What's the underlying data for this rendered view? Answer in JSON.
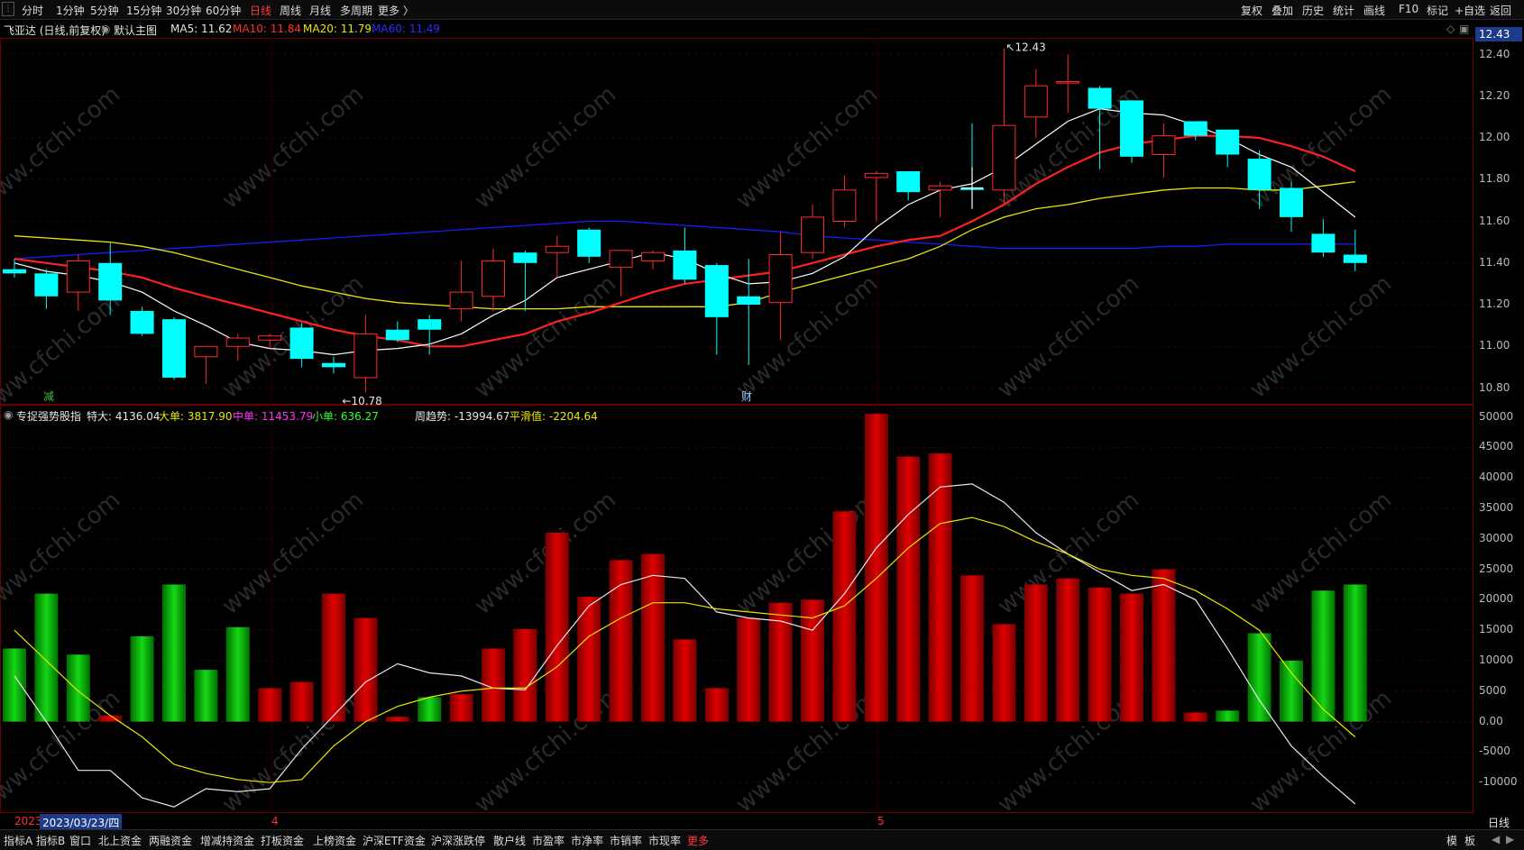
{
  "toolbar": {
    "periods": [
      "分时",
      "1分钟",
      "5分钟",
      "15分钟",
      "30分钟",
      "60分钟",
      "日线",
      "周线",
      "月线",
      "多周期",
      "更多 〉"
    ],
    "active_period": "日线",
    "right_buttons": [
      "复权",
      "叠加",
      "历史",
      "统计",
      "画线",
      "F10",
      "标记",
      "+自选",
      "返回"
    ]
  },
  "header": {
    "stock": "飞亚达 (日线,前复权)",
    "template": "默认主图",
    "ma5": "MA5: 11.62",
    "ma10": "MA10: 11.84",
    "ma20": "MA20: 11.79",
    "ma60": "MA60: 11.49",
    "last_price_tag": "12.43"
  },
  "colors": {
    "up": "#ff2b2b",
    "down": "#00ffff",
    "ma5": "#ffffff",
    "ma10": "#ff2020",
    "ma20": "#e8e800",
    "ma60": "#1a1aff",
    "border": "#6b0000",
    "flow_up": "#d00000",
    "flow_down": "#00b400"
  },
  "price_axis": [
    "12.40",
    "12.20",
    "12.00",
    "11.80",
    "11.60",
    "11.40",
    "11.20",
    "11.00",
    "10.80"
  ],
  "price_annotations": {
    "high": "12.43",
    "low": "10.78",
    "marker_jian": "减",
    "marker_cai": "财"
  },
  "indicator": {
    "name": "专捉强势股指",
    "tedan": "特大: 4136.04",
    "dadan": "大单: 3817.90",
    "zhongdan": "中单: 11453.79",
    "xiaodan": "小单: 636.27",
    "zhouqushi": "周趋势: -13994.67",
    "pinghua": "平滑值: -2204.64",
    "axis": [
      "50000",
      "45000",
      "40000",
      "35000",
      "30000",
      "25000",
      "20000",
      "15000",
      "10000",
      "5000",
      "0.00",
      "-5000",
      "-10000"
    ]
  },
  "date_axis": {
    "year": "2023",
    "cursor_date": "2023/03/23/四",
    "month_4": "4",
    "month_5": "5",
    "period": "日线"
  },
  "watermark": "www.cfchi.com",
  "bottom_tabs": [
    "指标A",
    "指标B",
    "窗口",
    "北上资金",
    "两融资金",
    "增减持资金",
    "打板资金",
    "上榜资金",
    "沪深ETF资金",
    "沪深涨跌停",
    "散户线",
    "市盈率",
    "市净率",
    "市销率",
    "市现率",
    "更多"
  ],
  "bottom_right": [
    "模",
    "板"
  ],
  "chart_data": {
    "type": "candlestick",
    "title": "飞亚达 (日线,前复权)",
    "ylim": [
      10.72,
      12.48
    ],
    "candles": [
      {
        "o": 11.37,
        "h": 11.42,
        "l": 11.33,
        "c": 11.35
      },
      {
        "o": 11.35,
        "h": 11.37,
        "l": 11.18,
        "c": 11.24
      },
      {
        "o": 11.26,
        "h": 11.44,
        "l": 11.17,
        "c": 11.41
      },
      {
        "o": 11.4,
        "h": 11.5,
        "l": 11.15,
        "c": 11.22
      },
      {
        "o": 11.17,
        "h": 11.19,
        "l": 11.05,
        "c": 11.06
      },
      {
        "o": 11.13,
        "h": 11.14,
        "l": 10.84,
        "c": 10.85
      },
      {
        "o": 10.95,
        "h": 11.0,
        "l": 10.82,
        "c": 11.0
      },
      {
        "o": 11.0,
        "h": 11.06,
        "l": 10.93,
        "c": 11.04
      },
      {
        "o": 11.03,
        "h": 11.06,
        "l": 10.99,
        "c": 11.05
      },
      {
        "o": 11.09,
        "h": 11.11,
        "l": 10.9,
        "c": 10.94
      },
      {
        "o": 10.92,
        "h": 10.95,
        "l": 10.87,
        "c": 10.9
      },
      {
        "o": 10.85,
        "h": 11.15,
        "l": 10.78,
        "c": 11.06
      },
      {
        "o": 11.08,
        "h": 11.12,
        "l": 11.02,
        "c": 11.03
      },
      {
        "o": 11.13,
        "h": 11.15,
        "l": 10.96,
        "c": 11.08
      },
      {
        "o": 11.18,
        "h": 11.41,
        "l": 11.12,
        "c": 11.26
      },
      {
        "o": 11.24,
        "h": 11.47,
        "l": 11.17,
        "c": 11.41
      },
      {
        "o": 11.45,
        "h": 11.46,
        "l": 11.17,
        "c": 11.4
      },
      {
        "o": 11.45,
        "h": 11.53,
        "l": 11.33,
        "c": 11.48
      },
      {
        "o": 11.56,
        "h": 11.57,
        "l": 11.4,
        "c": 11.43
      },
      {
        "o": 11.38,
        "h": 11.46,
        "l": 11.24,
        "c": 11.46
      },
      {
        "o": 11.41,
        "h": 11.46,
        "l": 11.37,
        "c": 11.45
      },
      {
        "o": 11.46,
        "h": 11.57,
        "l": 11.3,
        "c": 11.32
      },
      {
        "o": 11.39,
        "h": 11.4,
        "l": 10.96,
        "c": 11.14
      },
      {
        "o": 11.24,
        "h": 11.42,
        "l": 10.91,
        "c": 11.2
      },
      {
        "o": 11.21,
        "h": 11.55,
        "l": 11.03,
        "c": 11.44
      },
      {
        "o": 11.45,
        "h": 11.68,
        "l": 11.42,
        "c": 11.62
      },
      {
        "o": 11.6,
        "h": 11.82,
        "l": 11.57,
        "c": 11.75
      },
      {
        "o": 11.81,
        "h": 11.84,
        "l": 11.6,
        "c": 11.83
      },
      {
        "o": 11.84,
        "h": 11.84,
        "l": 11.7,
        "c": 11.74
      },
      {
        "o": 11.75,
        "h": 11.79,
        "l": 11.62,
        "c": 11.77
      },
      {
        "o": 11.76,
        "h": 12.07,
        "l": 11.66,
        "c": 11.75
      },
      {
        "o": 11.75,
        "h": 12.43,
        "l": 11.68,
        "c": 12.06
      },
      {
        "o": 12.1,
        "h": 12.33,
        "l": 12.0,
        "c": 12.25
      },
      {
        "o": 12.27,
        "h": 12.4,
        "l": 12.12,
        "c": 12.27
      },
      {
        "o": 12.24,
        "h": 12.25,
        "l": 11.85,
        "c": 12.14
      },
      {
        "o": 12.18,
        "h": 12.18,
        "l": 11.88,
        "c": 11.91
      },
      {
        "o": 11.92,
        "h": 12.07,
        "l": 11.81,
        "c": 12.01
      },
      {
        "o": 12.08,
        "h": 12.08,
        "l": 11.99,
        "c": 12.01
      },
      {
        "o": 12.04,
        "h": 12.04,
        "l": 11.86,
        "c": 11.92
      },
      {
        "o": 11.9,
        "h": 11.94,
        "l": 11.66,
        "c": 11.75
      },
      {
        "o": 11.76,
        "h": 11.79,
        "l": 11.55,
        "c": 11.62
      },
      {
        "o": 11.54,
        "h": 11.61,
        "l": 11.43,
        "c": 11.45
      },
      {
        "o": 11.44,
        "h": 11.56,
        "l": 11.36,
        "c": 11.4
      }
    ],
    "ma5": [
      11.4,
      11.36,
      11.34,
      11.31,
      11.26,
      11.17,
      11.1,
      11.02,
      10.99,
      10.98,
      10.96,
      10.98,
      10.99,
      11.01,
      11.06,
      11.15,
      11.22,
      11.33,
      11.37,
      11.41,
      11.45,
      11.42,
      11.35,
      11.3,
      11.31,
      11.35,
      11.43,
      11.57,
      11.68,
      11.75,
      11.78,
      11.86,
      11.97,
      12.08,
      12.14,
      12.12,
      12.11,
      12.06,
      12.0,
      11.92,
      11.86,
      11.74,
      11.62
    ],
    "ma10": [
      11.42,
      11.4,
      11.38,
      11.36,
      11.33,
      11.28,
      11.24,
      11.2,
      11.16,
      11.12,
      11.08,
      11.05,
      11.03,
      11.0,
      11.0,
      11.03,
      11.06,
      11.12,
      11.16,
      11.21,
      11.26,
      11.3,
      11.32,
      11.34,
      11.36,
      11.4,
      11.44,
      11.48,
      11.51,
      11.53,
      11.6,
      11.68,
      11.78,
      11.86,
      11.93,
      11.97,
      11.99,
      12.01,
      12.01,
      12.0,
      11.96,
      11.91,
      11.84
    ],
    "ma20": [
      11.53,
      11.52,
      11.51,
      11.5,
      11.48,
      11.45,
      11.41,
      11.37,
      11.33,
      11.29,
      11.26,
      11.23,
      11.21,
      11.2,
      11.19,
      11.18,
      11.18,
      11.18,
      11.19,
      11.19,
      11.19,
      11.19,
      11.19,
      11.21,
      11.26,
      11.3,
      11.34,
      11.38,
      11.42,
      11.48,
      11.56,
      11.62,
      11.66,
      11.68,
      11.71,
      11.73,
      11.75,
      11.76,
      11.76,
      11.75,
      11.75,
      11.77,
      11.79
    ],
    "ma60": [
      11.42,
      11.43,
      11.44,
      11.45,
      11.46,
      11.47,
      11.48,
      11.49,
      11.5,
      11.51,
      11.52,
      11.53,
      11.54,
      11.55,
      11.56,
      11.57,
      11.58,
      11.59,
      11.6,
      11.6,
      11.59,
      11.58,
      11.57,
      11.56,
      11.55,
      11.53,
      11.52,
      11.51,
      11.5,
      11.49,
      11.48,
      11.47,
      11.47,
      11.47,
      11.47,
      11.47,
      11.48,
      11.48,
      11.49,
      11.49,
      11.49,
      11.49,
      11.49
    ],
    "indicator_ylim": [
      -15000,
      52000
    ],
    "flow_bars": [
      12000,
      21000,
      11000,
      1000,
      14000,
      22500,
      8500,
      15500,
      5500,
      6500,
      21000,
      17000,
      800,
      4000,
      4500,
      12000,
      15200,
      31000,
      20500,
      26500,
      27500,
      13500,
      5500,
      17000,
      19500,
      20000,
      34500,
      50500,
      43500,
      44000,
      24000,
      16000,
      22500,
      23500,
      22000,
      21000,
      25000,
      1500,
      1800,
      14500,
      10000,
      21500,
      22500
    ],
    "flow_colors": [
      "g",
      "g",
      "g",
      "r",
      "g",
      "g",
      "g",
      "g",
      "r",
      "r",
      "r",
      "r",
      "r",
      "g",
      "r",
      "r",
      "r",
      "r",
      "r",
      "r",
      "r",
      "r",
      "r",
      "r",
      "r",
      "r",
      "r",
      "r",
      "r",
      "r",
      "r",
      "r",
      "r",
      "r",
      "r",
      "r",
      "r",
      "r",
      "g",
      "g",
      "g",
      "g",
      "g"
    ],
    "white_line": [
      7500,
      0,
      -8000,
      -8000,
      -12500,
      -14000,
      -11000,
      -11500,
      -11000,
      -4500,
      1000,
      6500,
      9500,
      8000,
      7500,
      5500,
      5200,
      12500,
      19000,
      22500,
      24000,
      23500,
      18000,
      17000,
      16500,
      15000,
      21000,
      28500,
      34000,
      38500,
      39000,
      36000,
      31000,
      27500,
      24500,
      21500,
      22500,
      20000,
      12000,
      3500,
      -4000,
      -9000,
      -13500
    ],
    "yellow_line": [
      15000,
      10000,
      5000,
      1000,
      -2500,
      -7000,
      -8500,
      -9500,
      -10000,
      -9500,
      -4000,
      0,
      2500,
      4000,
      5000,
      5500,
      5500,
      9000,
      14000,
      17000,
      19500,
      19500,
      18500,
      18000,
      17500,
      17000,
      19000,
      23500,
      28500,
      32500,
      33500,
      32000,
      29500,
      27500,
      25000,
      24000,
      23500,
      21500,
      18500,
      15000,
      8000,
      2000,
      -2500
    ]
  }
}
